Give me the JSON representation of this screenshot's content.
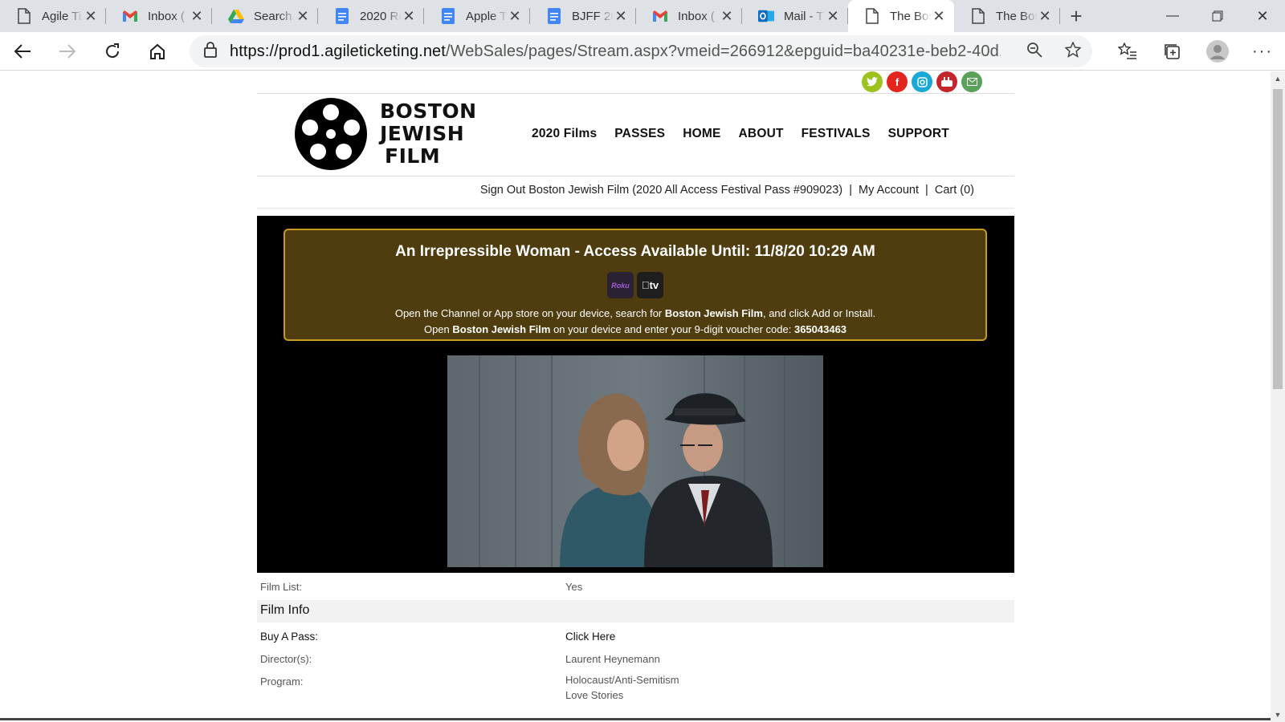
{
  "browser": {
    "tabs": [
      {
        "label": "Agile Ti",
        "icon": "page-icon"
      },
      {
        "label": "Inbox (",
        "icon": "gmail-icon"
      },
      {
        "label": "Search",
        "icon": "drive-icon"
      },
      {
        "label": "2020 Ro",
        "icon": "docs-icon"
      },
      {
        "label": "Apple T",
        "icon": "docs-icon"
      },
      {
        "label": "BJFF 20",
        "icon": "docs-icon"
      },
      {
        "label": "Inbox (",
        "icon": "gmail-icon"
      },
      {
        "label": "Mail - T",
        "icon": "outlook-icon"
      },
      {
        "label": "The Bos",
        "icon": "page-icon",
        "active": true
      },
      {
        "label": "The Bos",
        "icon": "page-icon"
      }
    ],
    "url_host": "https://prod1.agileticketing.net",
    "url_path": "/WebSales/pages/Stream.aspx?vmeid=266912&epguid=ba40231e-beb2-40d..."
  },
  "site": {
    "brand_lines": [
      "BOSTON",
      "JEWISH",
      "FILM"
    ],
    "nav": [
      "2020 Films",
      "PASSES",
      "HOME",
      "ABOUT",
      "FESTIVALS",
      "SUPPORT"
    ],
    "account_bar": "Sign Out Boston Jewish Film (2020 All Access Festival Pass #909023)  |  My Account  |  Cart (0)",
    "social": [
      {
        "name": "twitter",
        "color": "#9bc21d"
      },
      {
        "name": "facebook",
        "color": "#e2261d"
      },
      {
        "name": "instagram",
        "color": "#1aa9d6"
      },
      {
        "name": "youtube",
        "color": "#c4252a"
      },
      {
        "name": "email",
        "color": "#5aa25a"
      }
    ]
  },
  "stream": {
    "title": "An Irrepressible Woman - Access Available Until: 11/8/20 10:29 AM",
    "roku_label": "Roku",
    "appletv_label": "tv",
    "line1_pre": "Open the Channel or App store on your device, search for ",
    "line1_bold": "Boston Jewish Film",
    "line1_post": ", and click Add or Install.",
    "line2_pre": "Open ",
    "line2_bold": "Boston Jewish Film",
    "line2_mid": " on your device and enter your 9-digit voucher code: ",
    "line2_code": "365043463"
  },
  "info": {
    "film_list_label": "Film List:",
    "film_list_value": "Yes",
    "section_title": "Film Info",
    "buy_pass_label": "Buy A Pass:",
    "buy_pass_value": "Click Here",
    "director_label": "Director(s):",
    "director_value": "Laurent Heynemann",
    "program_label": "Program:",
    "program_values": [
      "Holocaust/Anti-Semitism",
      "Love Stories"
    ]
  }
}
